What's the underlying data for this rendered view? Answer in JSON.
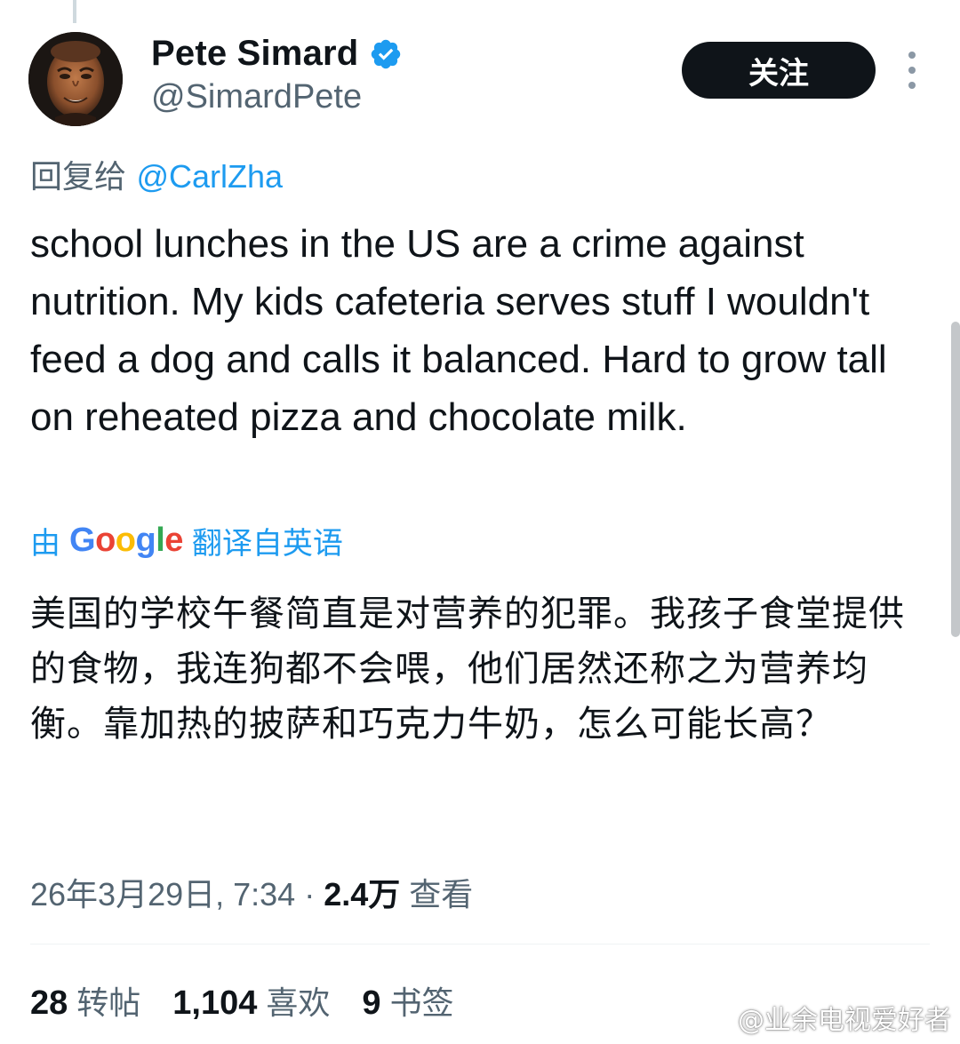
{
  "author": {
    "display_name": "Pete Simard",
    "handle": "@SimardPete",
    "verified": true
  },
  "follow_button_label": "关注",
  "reply_to": {
    "prefix": "回复给",
    "mention": "@CarlZha"
  },
  "tweet_text": "school lunches in the US are a crime against nutrition. My kids cafeteria serves stuff I wouldn't feed a dog and calls it balanced. Hard to grow tall on reheated pizza and chocolate milk.",
  "translation": {
    "prefix": "由",
    "provider": "Google",
    "suffix": "翻译自英语",
    "text": "美国的学校午餐简直是对营养的犯罪。我孩子食堂提供的食物，我连狗都不会喂，他们居然还称之为营养均衡。靠加热的披萨和巧克力牛奶，怎么可能长高？"
  },
  "meta": {
    "timestamp": "26年3月29日, 7:34",
    "separator": "·",
    "views_count": "2.4万",
    "views_label": "查看"
  },
  "stats": {
    "reposts_count": "28",
    "reposts_label": "转帖",
    "likes_count": "1,104",
    "likes_label": "喜欢",
    "bookmarks_count": "9",
    "bookmarks_label": "书签"
  },
  "watermark": "@业余电视爱好者",
  "colors": {
    "accent": "#1d9bf0",
    "text_primary": "#0f1419",
    "text_secondary": "#536471",
    "follow_button_bg": "#0f1419"
  },
  "icons": {
    "verified": "verified-badge-icon",
    "more": "more-options-icon",
    "watermark": "weibo-logo-icon"
  }
}
